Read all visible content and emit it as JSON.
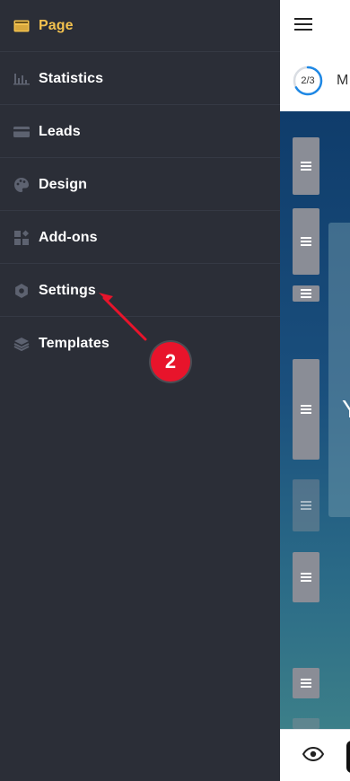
{
  "sidebar": {
    "items": [
      {
        "label": "Page",
        "icon": "page-icon",
        "active": true
      },
      {
        "label": "Statistics",
        "icon": "statistics-icon",
        "active": false
      },
      {
        "label": "Leads",
        "icon": "leads-icon",
        "active": false
      },
      {
        "label": "Design",
        "icon": "palette-icon",
        "active": false
      },
      {
        "label": "Add-ons",
        "icon": "addons-icon",
        "active": false
      },
      {
        "label": "Settings",
        "icon": "gear-icon",
        "active": false
      },
      {
        "label": "Templates",
        "icon": "layers-icon",
        "active": false
      }
    ]
  },
  "app": {
    "menu_icon": "hamburger-icon",
    "progress": {
      "text": "2/3",
      "fraction": 0.667,
      "color": "#1e88e5"
    },
    "step_title_visible": "M",
    "hero_text_visible": "Y",
    "preview_icon": "eye-icon"
  },
  "annotation": {
    "badge_text": "2",
    "color": "#e8142b"
  },
  "colors": {
    "sidebar_bg": "#2b2e37",
    "active_label": "#f2c14e",
    "label": "#ffffff"
  }
}
